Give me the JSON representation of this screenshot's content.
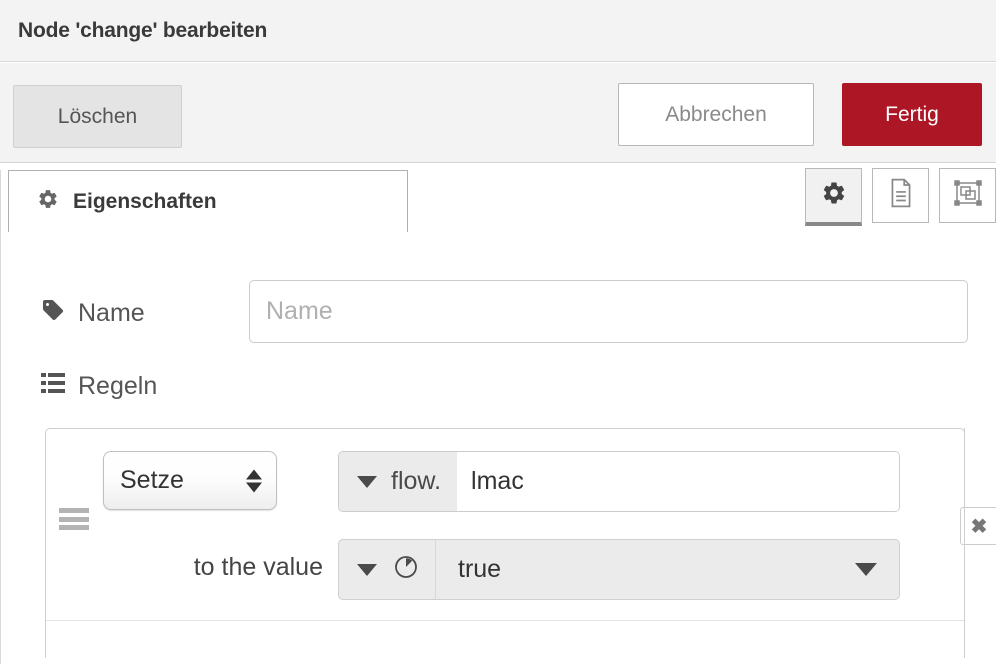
{
  "dialog": {
    "title": "Node 'change' bearbeiten"
  },
  "toolbar": {
    "delete_label": "Löschen",
    "cancel_label": "Abbrechen",
    "done_label": "Fertig",
    "done_color": "#ad1625"
  },
  "tabs": {
    "active": "Eigenschaften",
    "items": [
      {
        "label": "Eigenschaften",
        "icon": "gear-icon",
        "active": true
      }
    ],
    "icon_buttons": [
      {
        "icon": "gear-icon",
        "name": "properties",
        "active": true
      },
      {
        "icon": "document-icon",
        "name": "description",
        "active": false
      },
      {
        "icon": "appearance-icon",
        "name": "appearance",
        "active": false
      }
    ]
  },
  "form": {
    "name": {
      "icon": "tag-icon",
      "label": "Name",
      "value": "",
      "placeholder": "Name"
    },
    "rules": {
      "icon": "list-icon",
      "label": "Regeln",
      "items": [
        {
          "action": "Setze",
          "property_scope": "flow.",
          "property_name": "lmac",
          "property_placeholder": "",
          "value_connector": "to the value",
          "value_type_icon": "boolean-icon",
          "value": "true",
          "delete_label": "✖"
        }
      ]
    }
  }
}
